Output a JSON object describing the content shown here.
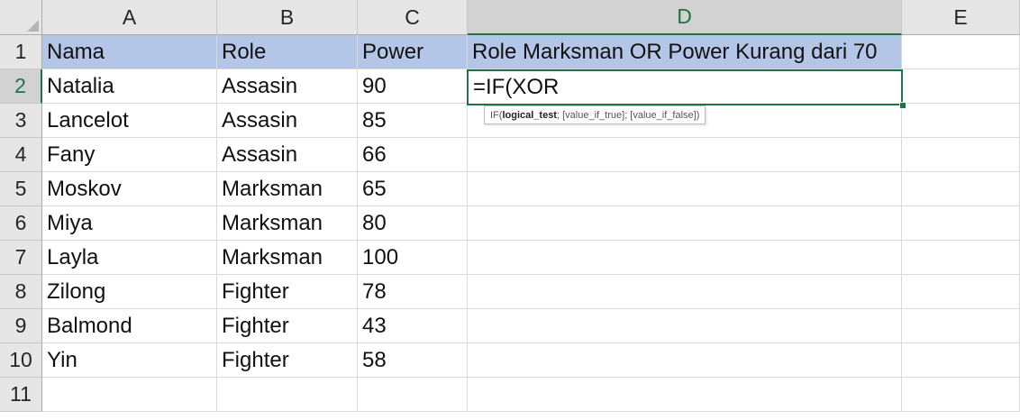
{
  "columns": [
    "A",
    "B",
    "C",
    "D",
    "E"
  ],
  "active_column": "D",
  "rows": [
    "1",
    "2",
    "3",
    "4",
    "5",
    "6",
    "7",
    "8",
    "9",
    "10",
    "11"
  ],
  "active_row": "2",
  "header": {
    "a": "Nama",
    "b": "Role",
    "c": "Power",
    "d": "Role Marksman OR Power Kurang dari 70"
  },
  "data": [
    {
      "nama": "Natalia",
      "role": "Assasin",
      "power": "90"
    },
    {
      "nama": "Lancelot",
      "role": "Assasin",
      "power": "85"
    },
    {
      "nama": "Fany",
      "role": "Assasin",
      "power": "66"
    },
    {
      "nama": "Moskov",
      "role": "Marksman",
      "power": "65"
    },
    {
      "nama": "Miya",
      "role": "Marksman",
      "power": "80"
    },
    {
      "nama": "Layla",
      "role": "Marksman",
      "power": "100"
    },
    {
      "nama": "Zilong",
      "role": "Fighter",
      "power": "78"
    },
    {
      "nama": "Balmond",
      "role": "Fighter",
      "power": "43"
    },
    {
      "nama": "Yin",
      "role": "Fighter",
      "power": "58"
    }
  ],
  "active_cell": {
    "formula": "=IF(XOR"
  },
  "tooltip": {
    "fn": "IF(",
    "arg1": "logical_test",
    "rest": "; [value_if_true]; [value_if_false])"
  },
  "colors": {
    "header_fill": "#b4c6e7",
    "accent": "#217346"
  }
}
